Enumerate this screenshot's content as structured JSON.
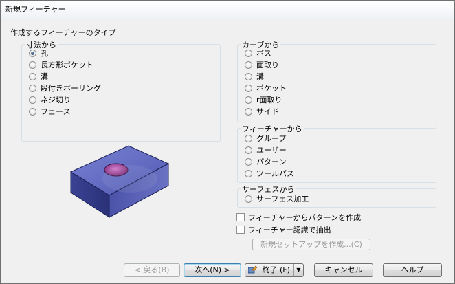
{
  "window": {
    "title": "新規フィーチャー"
  },
  "heading": "作成するフィーチャーのタイプ",
  "groups": {
    "dimension": {
      "title": "寸法から",
      "options": [
        {
          "label": "孔",
          "checked": true
        },
        {
          "label": "長方形ポケット",
          "checked": false
        },
        {
          "label": "溝",
          "checked": false
        },
        {
          "label": "段付きボーリング",
          "checked": false
        },
        {
          "label": "ネジ切り",
          "checked": false
        },
        {
          "label": "フェース",
          "checked": false
        }
      ]
    },
    "curve": {
      "title": "カーブから",
      "options": [
        {
          "label": "ボス",
          "checked": false
        },
        {
          "label": "面取り",
          "checked": false
        },
        {
          "label": "溝",
          "checked": false
        },
        {
          "label": "ポケット",
          "checked": false
        },
        {
          "label": "r面取り",
          "checked": false
        },
        {
          "label": "サイド",
          "checked": false
        }
      ]
    },
    "feature": {
      "title": "フィーチャーから",
      "options": [
        {
          "label": "グループ",
          "checked": false
        },
        {
          "label": "ユーザー",
          "checked": false
        },
        {
          "label": "パターン",
          "checked": false
        },
        {
          "label": "ツールパス",
          "checked": false
        }
      ]
    },
    "surface": {
      "title": "サーフェスから",
      "options": [
        {
          "label": "サーフェス加工",
          "checked": false
        }
      ]
    }
  },
  "checkboxes": [
    {
      "label": "フィーチャーからパターンを作成",
      "checked": false
    },
    {
      "label": "フィーチャー認識で抽出",
      "checked": false
    }
  ],
  "new_setup_button": "新規セットアップを作成...(C)",
  "footer": {
    "back": "< 戻る(B)",
    "next": "次へ(N) >",
    "finish": "終了 (F)",
    "cancel": "キャンセル",
    "help": "ヘルプ"
  },
  "colors": {
    "block_face": "#5863b8",
    "block_dark": "#2b3275",
    "hole": "#a04f9a"
  }
}
